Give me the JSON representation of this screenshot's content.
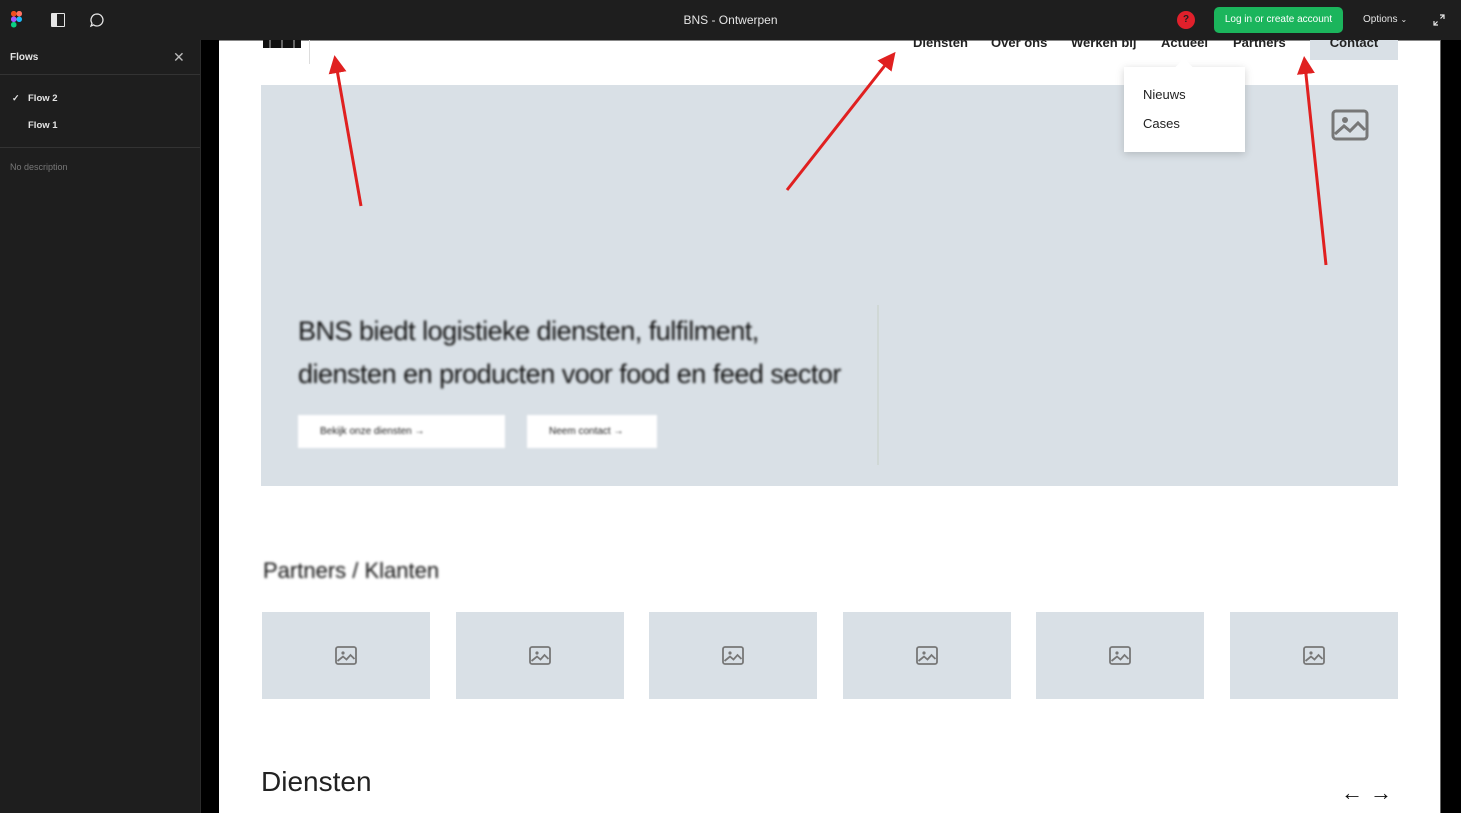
{
  "app": {
    "title": "BNS - Ontwerpen",
    "help_label": "?",
    "login_label": "Log in or create account",
    "options_label": "Options",
    "options_chevron": "⌄",
    "colors": {
      "login": "#1bb55c",
      "help": "#e0202b",
      "placeholder": "#d9e0e6",
      "annotation": "#e02020"
    }
  },
  "sidebar": {
    "title": "Flows",
    "close_glyph": "✕",
    "flows": [
      {
        "label": "Flow 2",
        "selected": true,
        "check": "✓"
      },
      {
        "label": "Flow 1",
        "selected": false,
        "check": ""
      }
    ],
    "description": "No description"
  },
  "site": {
    "nav": [
      "Diensten",
      "Over ons",
      "Werken bij",
      "Actueel",
      "Partners"
    ],
    "contact_label": "Contact",
    "dropdown": [
      "Nieuws",
      "Cases"
    ],
    "hero": {
      "headline": "BNS biedt logistieke diensten, fulfilment, diensten en producten voor food en feed sector",
      "button_primary": "Bekijk onze diensten  →",
      "button_secondary": "Neem contact  →"
    },
    "partners_title": "Partners / Klanten",
    "partner_logos": 6,
    "diensten_title": "Diensten",
    "prev_arrow": "←",
    "next_arrow": "→"
  }
}
